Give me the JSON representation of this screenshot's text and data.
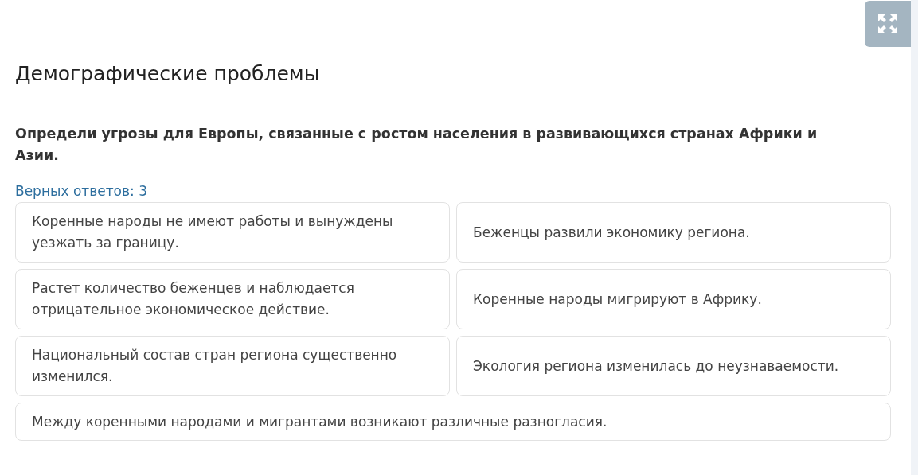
{
  "title": "Демографические проблемы",
  "question": "Определи угрозы для Европы, связанные с ростом населения в развивающихся странах Африки и Азии.",
  "answer_count": "Верных ответов: 3",
  "options": [
    {
      "text": "Коренные народы не имеют работы и вынуждены уезжать за границу.",
      "kind": "half"
    },
    {
      "text": "Беженцы развили экономику региона.",
      "kind": "half"
    },
    {
      "text": "Растет количество беженцев и наблюдается отрицательное экономическое действие.",
      "kind": "half"
    },
    {
      "text": "Коренные народы мигрируют в Африку.",
      "kind": "half"
    },
    {
      "text": "Национальный состав стран региона существенно изменился.",
      "kind": "half"
    },
    {
      "text": "Экология региона изменилась до неузнаваемости.",
      "kind": "half"
    },
    {
      "text": "Между коренными народами и мигрантами возникают различные разногласия.",
      "kind": "wide"
    }
  ]
}
